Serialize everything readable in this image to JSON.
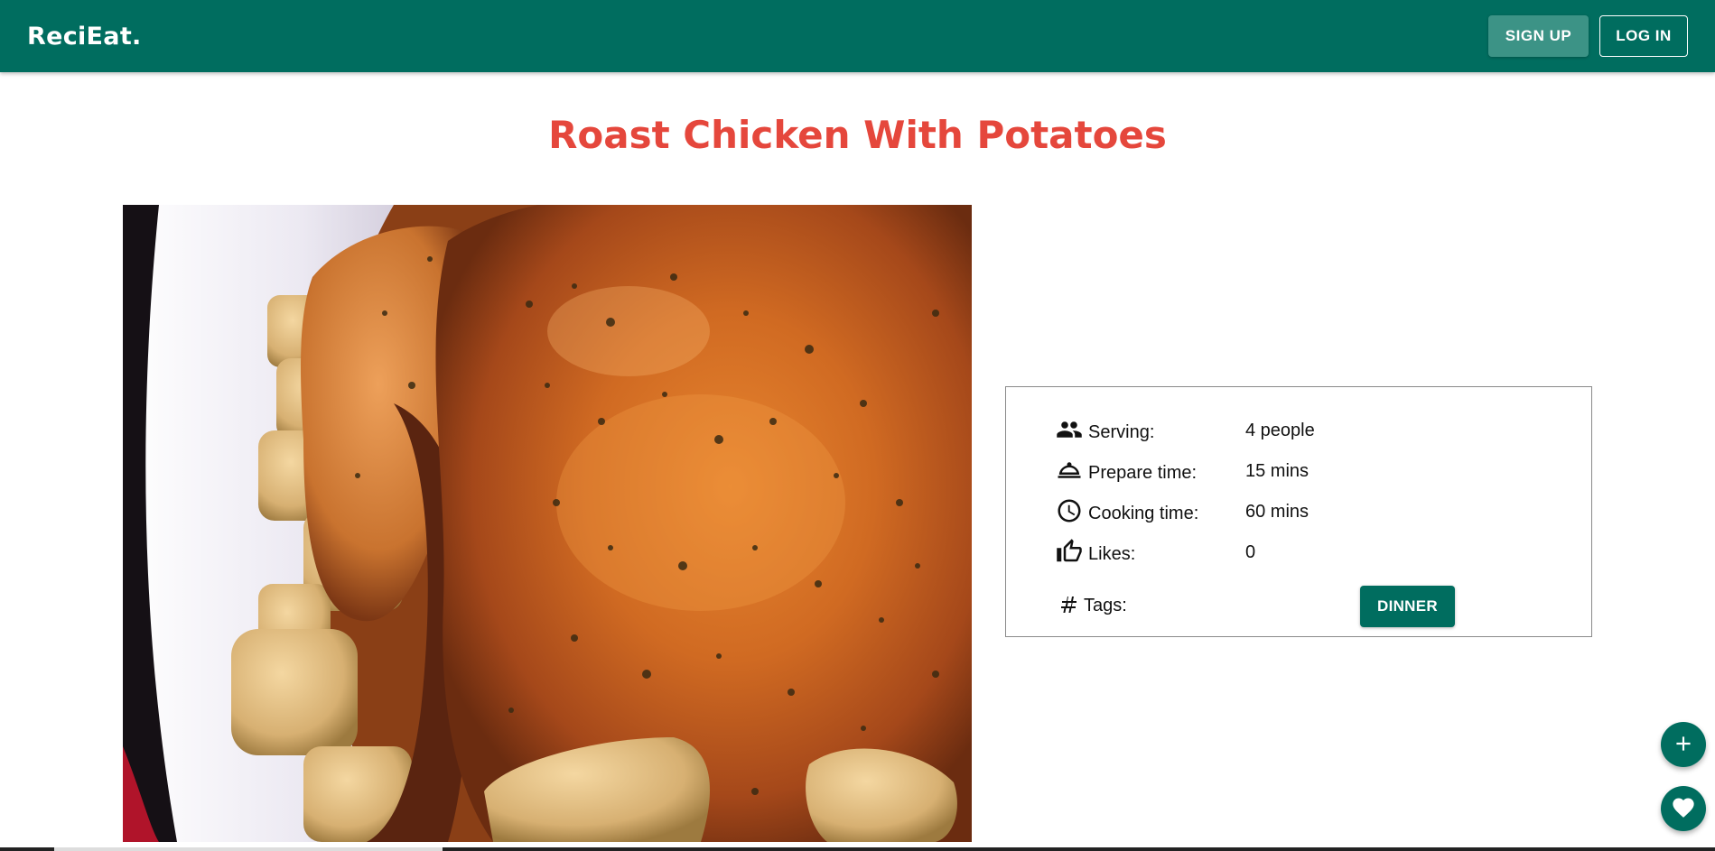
{
  "header": {
    "brand": "ReciEat.",
    "signup_label": "SIGN UP",
    "login_label": "LOG IN"
  },
  "recipe": {
    "title": "Roast Chicken With Potatoes"
  },
  "details": [
    {
      "icon": "people-icon",
      "label": "Serving:",
      "value": "4 people"
    },
    {
      "icon": "dish-cover-icon",
      "label": "Prepare time:",
      "value": "15 mins"
    },
    {
      "icon": "clock-icon",
      "label": "Cooking time:",
      "value": "60 mins"
    },
    {
      "icon": "thumbs-up-icon",
      "label": "Likes:",
      "value": "0"
    }
  ],
  "tags": {
    "icon": "hash-icon",
    "label": "Tags:",
    "items": [
      "DINNER"
    ]
  },
  "fabs": {
    "add_icon": "plus-icon",
    "favorite_icon": "heart-icon"
  },
  "colors": {
    "primary": "#006d5f",
    "title_red": "#e5473c",
    "signup_bg": "#3c9386"
  }
}
